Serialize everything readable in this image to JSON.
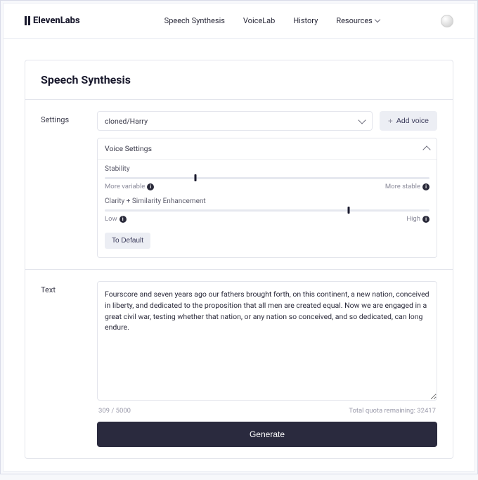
{
  "brand": "ElevenLabs",
  "nav": {
    "speech_synthesis": "Speech Synthesis",
    "voicelab": "VoiceLab",
    "history": "History",
    "resources": "Resources"
  },
  "page_title": "Speech Synthesis",
  "settings": {
    "label": "Settings",
    "voice_selected": "cloned/Harry",
    "add_voice_label": "Add voice",
    "panel_title": "Voice Settings",
    "stability": {
      "title": "Stability",
      "left": "More variable",
      "right": "More stable",
      "percent": 28
    },
    "clarity": {
      "title": "Clarity + Similarity Enhancement",
      "left": "Low",
      "right": "High",
      "percent": 75
    },
    "default_label": "To Default"
  },
  "text": {
    "label": "Text",
    "value": "Fourscore and seven years ago our fathers brought forth, on this continent, a new nation, conceived in liberty, and dedicated to the proposition that all men are created equal. Now we are engaged in a great civil war, testing whether that nation, or any nation so conceived, and so dedicated, can long endure.",
    "char_count": "309 / 5000",
    "quota": "Total quota remaining: 32417",
    "generate_label": "Generate"
  }
}
